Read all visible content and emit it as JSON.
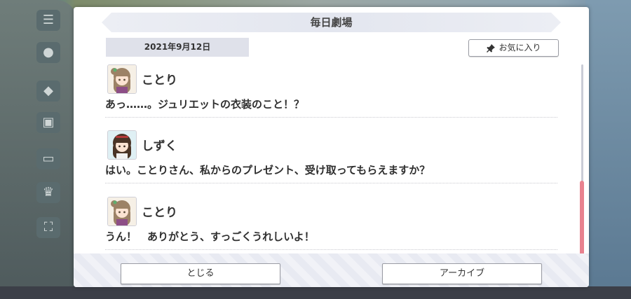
{
  "dialog": {
    "title": "毎日劇場",
    "date": "2021年9月12日",
    "favorite_label": "お気に入り",
    "close_label": "とじる",
    "archive_label": "アーカイブ"
  },
  "entries": [
    {
      "speaker": "ことり",
      "text": "あっ……。ジュリエットの衣装のこと！？",
      "avatar": "kotori-avatar"
    },
    {
      "speaker": "しずく",
      "text": "はい。ことりさん、私からのプレゼント、受け取ってもらえますか？",
      "avatar": "shizuku-avatar"
    },
    {
      "speaker": "ことり",
      "text": "うん！　ありがとう、すっごくうれしいよ！",
      "avatar": "kotori-avatar"
    }
  ],
  "colors": {
    "scroll_thumb": "#e8828f",
    "title_bar": "#e3e6ef",
    "date_box": "#dfe1ea"
  }
}
